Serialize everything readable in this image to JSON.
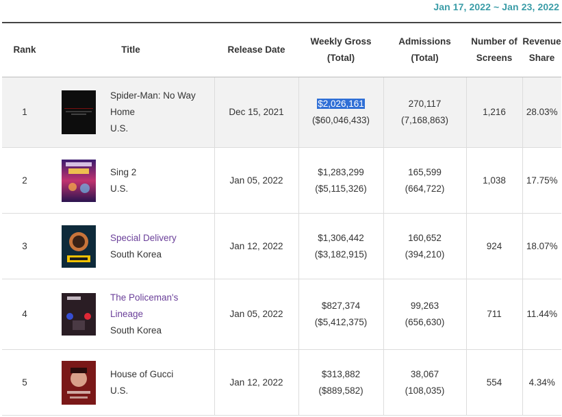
{
  "date_range": "Jan 17, 2022 ~ Jan 23, 2022",
  "columns": {
    "rank": "Rank",
    "title": "Title",
    "release_date": "Release Date",
    "weekly_gross_line1": "Weekly Gross",
    "weekly_gross_line2": "(Total)",
    "admissions_line1": "Admissions",
    "admissions_line2": "(Total)",
    "screens_line1": "Number of",
    "screens_line2": "Screens",
    "revenue_line1": "Revenue",
    "revenue_line2": "Share"
  },
  "rows": [
    {
      "rank": "1",
      "title_line1": "Spider-Man: No Way",
      "title_line2": "Home",
      "country": "U.S.",
      "release_date": "Dec 15, 2021",
      "weekly_gross": "$2,026,161",
      "total_gross": "($60,046,433)",
      "admissions": "270,117",
      "total_admissions": "(7,168,863)",
      "screens": "1,216",
      "revenue_share": "28.03%"
    },
    {
      "rank": "2",
      "title_line1": "Sing 2",
      "title_line2": "",
      "country": "U.S.",
      "release_date": "Jan 05, 2022",
      "weekly_gross": "$1,283,299",
      "total_gross": "($5,115,326)",
      "admissions": "165,599",
      "total_admissions": "(664,722)",
      "screens": "1,038",
      "revenue_share": "17.75%"
    },
    {
      "rank": "3",
      "title_line1": "Special Delivery",
      "title_line2": "",
      "country": "South Korea",
      "release_date": "Jan 12, 2022",
      "weekly_gross": "$1,306,442",
      "total_gross": "($3,182,915)",
      "admissions": "160,652",
      "total_admissions": "(394,210)",
      "screens": "924",
      "revenue_share": "18.07%"
    },
    {
      "rank": "4",
      "title_line1": "The Policeman's",
      "title_line2": "Lineage",
      "country": "South Korea",
      "release_date": "Jan 05, 2022",
      "weekly_gross": "$827,374",
      "total_gross": "($5,412,375)",
      "admissions": "99,263",
      "total_admissions": "(656,630)",
      "screens": "711",
      "revenue_share": "11.44%"
    },
    {
      "rank": "5",
      "title_line1": "House of Gucci",
      "title_line2": "",
      "country": "U.S.",
      "release_date": "Jan 12, 2022",
      "weekly_gross": "$313,882",
      "total_gross": "($889,582)",
      "admissions": "38,067",
      "total_admissions": "(108,035)",
      "screens": "554",
      "revenue_share": "4.34%"
    }
  ]
}
